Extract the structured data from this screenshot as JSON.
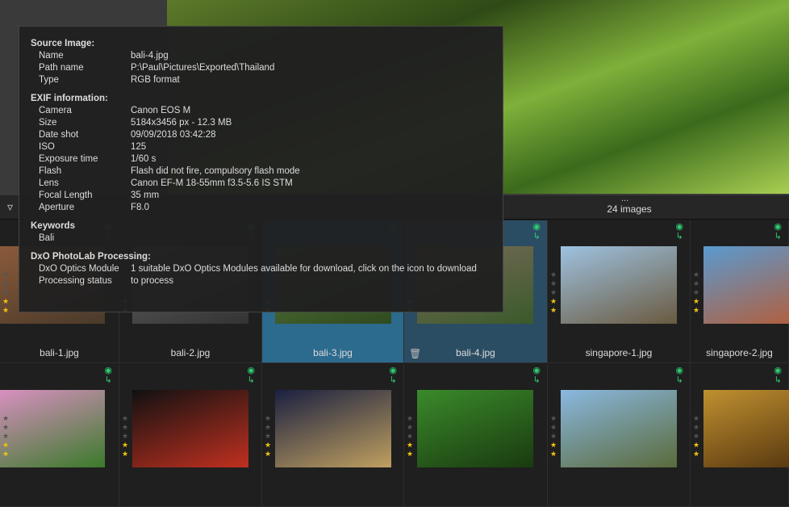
{
  "toolbar": {
    "filter_icon": "filter-icon",
    "more": "...",
    "image_count": "24 images"
  },
  "tooltip": {
    "source": {
      "title": "Source Image:",
      "rows": [
        [
          "Name",
          "bali-4.jpg"
        ],
        [
          "Path name",
          "P:\\Paul\\Pictures\\Exported\\Thailand"
        ],
        [
          "Type",
          "RGB format"
        ]
      ]
    },
    "exif": {
      "title": "EXIF information:",
      "rows": [
        [
          "Camera",
          "Canon EOS M"
        ],
        [
          "Size",
          "5184x3456  px - 12.3 MB"
        ],
        [
          "Date shot",
          "09/09/2018 03:42:28"
        ],
        [
          "ISO",
          "125"
        ],
        [
          "Exposure time",
          "1/60 s"
        ],
        [
          "Flash",
          "Flash did not fire, compulsory flash mode"
        ],
        [
          "Lens",
          "Canon EF-M 18-55mm f3.5-5.6 IS STM"
        ],
        [
          "Focal Length",
          "35  mm"
        ],
        [
          "Aperture",
          "F8.0"
        ]
      ]
    },
    "keywords": {
      "title": "Keywords",
      "value": "Bali"
    },
    "processing": {
      "title": "DxO PhotoLab Processing:",
      "rows": [
        [
          "DxO Optics Module",
          "1 suitable DxO Optics Modules available for download, click on the icon to download"
        ],
        [
          "Processing status",
          "to process"
        ]
      ]
    }
  },
  "grid": {
    "row1": [
      {
        "name": "bali-1.jpg",
        "rating": 2,
        "colors": [
          "#8a5a3a",
          "#4a3a2a"
        ]
      },
      {
        "name": "bali-2.jpg",
        "rating": 2,
        "colors": [
          "#666",
          "#333"
        ]
      },
      {
        "name": "bali-3.jpg",
        "rating": 2,
        "colors": [
          "#5a7a3a",
          "#2f4a20"
        ],
        "selected": true
      },
      {
        "name": "bali-4.jpg",
        "rating": 2,
        "colors": [
          "#7a6a5a",
          "#3a5a2a"
        ],
        "selected": true
      },
      {
        "name": "singapore-1.jpg",
        "rating": 2,
        "colors": [
          "#9ec2e0",
          "#6a5a40"
        ]
      },
      {
        "name": "singapore-2.jpg",
        "rating": 2,
        "colors": [
          "#5a9ad0",
          "#b06040"
        ]
      }
    ],
    "row2": [
      {
        "rating": 2,
        "colors": [
          "#d890c0",
          "#3a7a2a"
        ]
      },
      {
        "rating": 2,
        "colors": [
          "#111",
          "#c03020"
        ]
      },
      {
        "rating": 2,
        "colors": [
          "#1a2040",
          "#c0a060"
        ]
      },
      {
        "rating": 2,
        "colors": [
          "#3a8a2a",
          "#1a3a10"
        ]
      },
      {
        "rating": 2,
        "colors": [
          "#8ab8e0",
          "#5a6a3a"
        ]
      },
      {
        "rating": 2,
        "colors": [
          "#c09030",
          "#5a3a10"
        ]
      }
    ]
  },
  "colors": {
    "selected": "#2c6a8e",
    "accent_icon": "#2ecc71",
    "star": "#f1c40f"
  }
}
